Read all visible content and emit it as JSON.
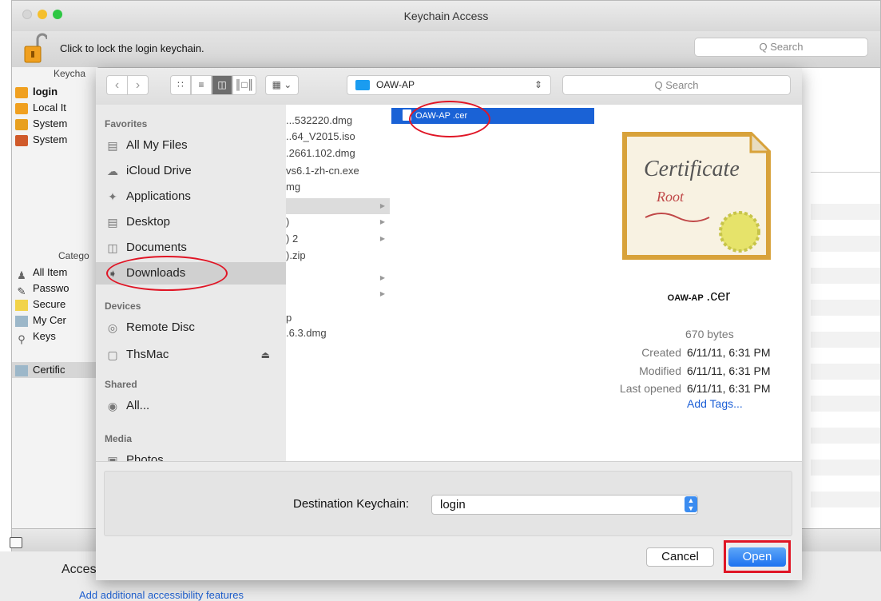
{
  "background": {
    "section_title": "Acces",
    "link": "Add additional accessibility features"
  },
  "keychain_window": {
    "title": "Keychain Access",
    "lock_text": "Click to lock the login keychain.",
    "search_placeholder": "Q Search",
    "keychains_header": "Keycha",
    "keychains": [
      "login",
      "Local It",
      "System",
      "System"
    ],
    "categories_header": "Catego",
    "categories": [
      "All Item",
      "Passwo",
      "Secure",
      "My Cer",
      "Keys",
      "Certific"
    ]
  },
  "open_sheet": {
    "path_folder": "OAW-AP",
    "search_placeholder": "Q Search",
    "sidebar": {
      "favorites_label": "Favorites",
      "favorites": [
        "All My Files",
        "iCloud Drive",
        "Applications",
        "Desktop",
        "Documents",
        "Downloads"
      ],
      "devices_label": "Devices",
      "devices": [
        "Remote Disc",
        "ThsMac"
      ],
      "shared_label": "Shared",
      "shared": [
        "All..."
      ],
      "media_label": "Media",
      "media": [
        "Photos"
      ]
    },
    "column1": [
      "...532220.dmg",
      "..64_V2015.iso",
      ".2661.102.dmg",
      "vs6.1-zh-cn.exe",
      "mg",
      "",
      ")",
      ") 2",
      ").zip",
      "",
      "",
      "p",
      ".6.3.dmg"
    ],
    "column2_selected": "OAW-AP .cer",
    "preview": {
      "name_prefix": "OAW-AP",
      "name_ext": ".cer",
      "size": "670 bytes",
      "created_label": "Created",
      "created": "6/11/11, 6:31 PM",
      "modified_label": "Modified",
      "modified": "6/11/11, 6:31 PM",
      "opened_label": "Last opened",
      "opened": "6/11/11, 6:31 PM",
      "add_tags": "Add Tags...",
      "cert_line1": "Certificate",
      "cert_line2": "Root"
    },
    "destination_label": "Destination Keychain:",
    "destination_value": "login",
    "cancel_label": "Cancel",
    "open_label": "Open"
  }
}
